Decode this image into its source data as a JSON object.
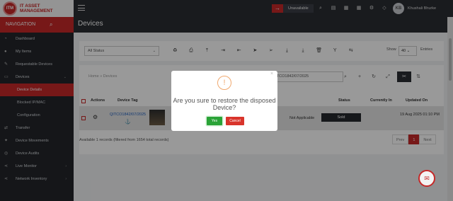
{
  "app": {
    "logo_mark": "ITM",
    "logo_line1": "IT ASSET",
    "logo_line2": "MANAGEMENT",
    "brand_color": "#c62828"
  },
  "header": {
    "status_label": "Unavailable",
    "icons": [
      "search-icon",
      "clipboard-icon",
      "calendar-icon",
      "grid-icon",
      "gear-icon",
      "tag-icon",
      "power-icon"
    ],
    "avatar_initials": "KB",
    "user_name": "Khushali Bhurke"
  },
  "sidebar": {
    "title": "NAVIGATION",
    "items": [
      {
        "label": "Dashboard"
      },
      {
        "label": "My Items"
      },
      {
        "label": "Requestable Devices"
      },
      {
        "label": "Devices"
      },
      {
        "label": "Device Details"
      },
      {
        "label": "Blocked IP/MAC"
      },
      {
        "label": "Configuration"
      },
      {
        "label": "Transfer"
      },
      {
        "label": "Device Movements"
      },
      {
        "label": "Device Audits"
      },
      {
        "label": "Live Monitor"
      },
      {
        "label": "Network Inventory"
      }
    ]
  },
  "page": {
    "title": "Devices"
  },
  "toolbar": {
    "status_filter": "All Status",
    "show_label": "Show",
    "page_size": "40",
    "entries_label": "Entries"
  },
  "breadcrumb": {
    "home": "Home",
    "separator": "»",
    "current": "Devices"
  },
  "search": {
    "value": "QITCO1842/07/2025"
  },
  "table": {
    "headers": {
      "actions": "Actions",
      "device_tag": "Device Tag",
      "status": "Status",
      "currently_in": "Currently In",
      "updated_on": "Updated On"
    },
    "rows": [
      {
        "device_tag": "QITCO1842/07/2025",
        "applicability": "Not Applicable",
        "status": "Sold",
        "currently_in": "",
        "updated_on": "19 Aug 2025 01:10 PM"
      }
    ]
  },
  "footer": {
    "info": "Available 1 records (filtered from 1654 total records)"
  },
  "pagination": {
    "prev": "Prev",
    "current": "1",
    "next": "Next"
  },
  "modal": {
    "message": "Are you sure to restore the disposed Device?",
    "yes_label": "Yes",
    "cancel_label": "Cancel"
  }
}
